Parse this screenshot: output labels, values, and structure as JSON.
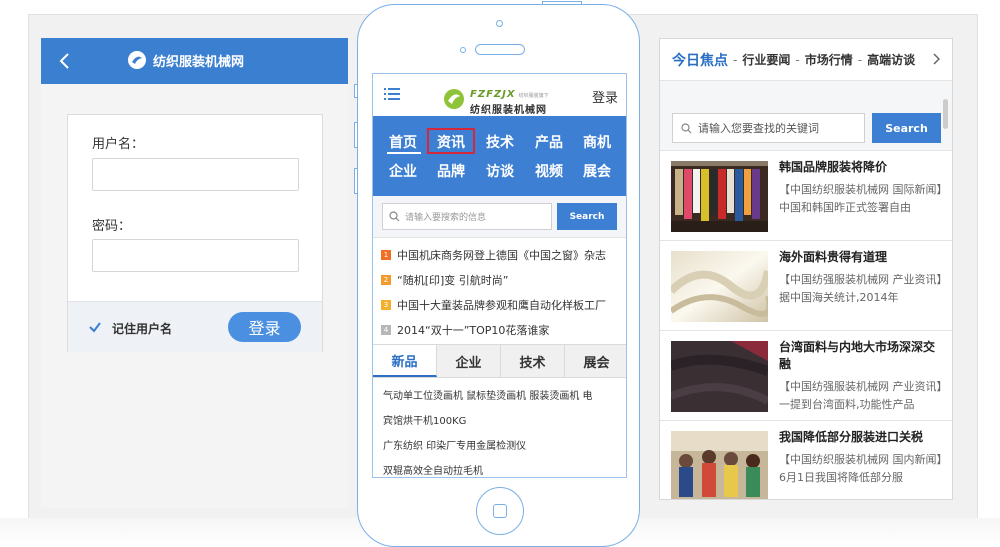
{
  "login": {
    "title": "纺织服装机械网",
    "username_label": "用户名：",
    "password_label": "密码：",
    "remember_label": "记住用户名",
    "remember_checked": true,
    "login_button": "登录"
  },
  "mobile": {
    "logo_en": "FZFZJX",
    "logo_en_tag": "纺织服装旗下",
    "logo_cn": "纺织服装机械网",
    "login_link": "登录",
    "nav_row1": [
      "首页",
      "资讯",
      "技术",
      "产品",
      "商机"
    ],
    "nav_row2": [
      "企业",
      "品牌",
      "访谈",
      "视频",
      "展会"
    ],
    "search_placeholder": "请输入要搜索的信息",
    "search_button": "Search",
    "ranking": [
      {
        "num": "1",
        "text": "中国机床商务网登上德国《中国之窗》杂志",
        "color": "#f06f22"
      },
      {
        "num": "2",
        "text": "“随机[印]变 引航时尚”",
        "color": "#f49a2c"
      },
      {
        "num": "3",
        "text": "中国十大童装品牌参观和鹰自动化样板工厂",
        "color": "#f4b02c"
      },
      {
        "num": "4",
        "text": "2014“双十一”TOP10花落谁家",
        "color": "#b7b7b7"
      }
    ],
    "tabs": [
      "新品",
      "企业",
      "技术",
      "展会"
    ],
    "products": [
      "气动单工位烫画机 鼠标垫烫画机 服装烫画机 电",
      "宾馆烘干机100KG",
      "广东纺织 印染厂专用金属检测仪",
      "双辊高效全自动拉毛机"
    ]
  },
  "news": {
    "tabs": [
      "今日焦点",
      "行业要闻",
      "市场行情",
      "高端访谈"
    ],
    "search_placeholder": "请输入您要查找的关键词",
    "search_button": "Search",
    "items": [
      {
        "title": "韩国品牌服装将降价",
        "desc": "【中国纺织服装机械网 国际新闻】中国和韩国昨正式签署自由"
      },
      {
        "title": "海外面料贵得有道理",
        "desc": "【中国纺强服装机械网 产业资讯】据中国海关统计,2014年"
      },
      {
        "title": "台湾面料与内地大市场深深交融",
        "desc": "【中国纺强服装机械网 产业资讯】一提到台湾面料,功能性产品"
      },
      {
        "title": "我国降低部分服装进口关税",
        "desc": "【中国纺织服装机械网 国内新闻】6月1日我国将降低部分服"
      }
    ]
  },
  "colors": {
    "brand_blue": "#3c7fd3",
    "active_red": "#d5283d",
    "phone_outline": "#7ab0e6"
  }
}
